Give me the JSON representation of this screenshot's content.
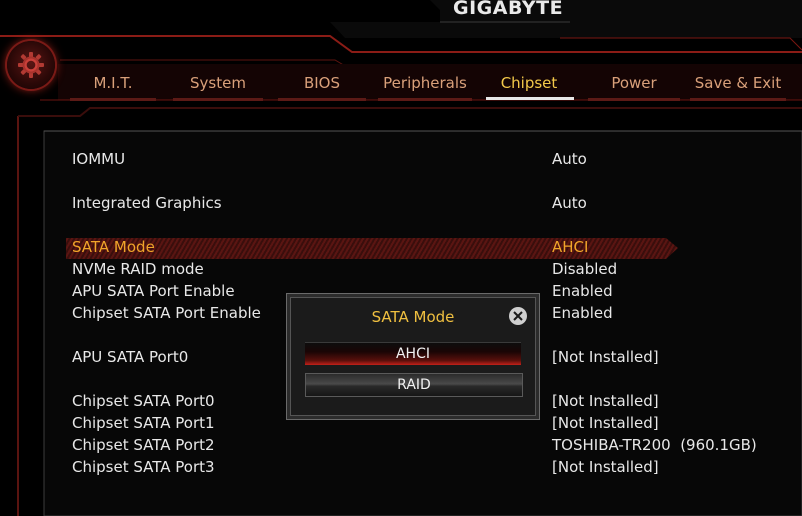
{
  "brand": "GIGABYTE",
  "brand_mark": "™",
  "tabs": [
    {
      "label": "M.I.T."
    },
    {
      "label": "System"
    },
    {
      "label": "BIOS"
    },
    {
      "label": "Peripherals"
    },
    {
      "label": "Chipset"
    },
    {
      "label": "Power"
    },
    {
      "label": "Save & Exit"
    }
  ],
  "active_tab": "Chipset",
  "settings": [
    {
      "label": "IOMMU",
      "value": "Auto"
    },
    {
      "label": "Integrated Graphics",
      "value": "Auto"
    },
    {
      "label": "SATA Mode",
      "value": "AHCI"
    },
    {
      "label": "NVMe RAID mode",
      "value": "Disabled"
    },
    {
      "label": "APU SATA Port Enable",
      "value": "Enabled"
    },
    {
      "label": "Chipset SATA Port Enable",
      "value": "Enabled"
    },
    {
      "label": "APU SATA Port0",
      "value": "[Not Installed]"
    },
    {
      "label": "Chipset SATA Port0",
      "value": "[Not Installed]"
    },
    {
      "label": "Chipset SATA Port1",
      "value": "[Not Installed]"
    },
    {
      "label": "Chipset SATA Port2",
      "value": "TOSHIBA-TR200  (960.1GB)"
    },
    {
      "label": "Chipset SATA Port3",
      "value": "[Not Installed]"
    }
  ],
  "selected_setting": "SATA Mode",
  "popup": {
    "title": "SATA Mode",
    "options": [
      "AHCI",
      "RAID"
    ],
    "highlighted": "AHCI",
    "close_icon": "close-icon"
  },
  "colors": {
    "accent_red": "#c1271d",
    "selected_text": "#f0a52a",
    "tab_active": "#f3c94a",
    "tab_inactive": "#d9a07a",
    "popup_title": "#f0c040"
  }
}
